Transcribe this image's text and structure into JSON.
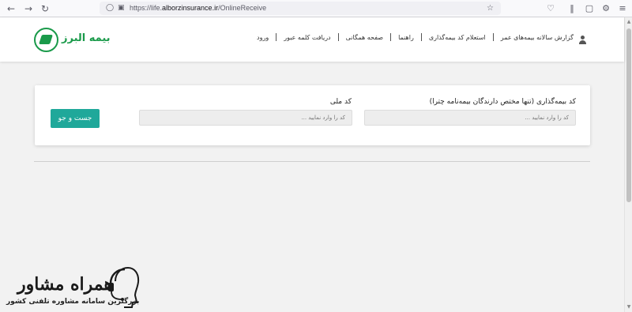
{
  "browser": {
    "url_prefix": "https://life.",
    "url_domain": "alborzinsurance.ir",
    "url_path": "/OnlineReceive"
  },
  "site": {
    "logo_text": "بیمه البرز",
    "nav": {
      "login": "ورود",
      "recover_password": "دریافت کلمه عبور",
      "public_page": "صفحه همگانی",
      "guide": "راهنما",
      "code_inquiry": "استعلام کد بیمه‌گذاری",
      "annual_report": "گزارش سالانه بیمه‌های عمر"
    }
  },
  "search": {
    "insurer_code_label": "کد بیمه‌گذاری (تنها مختص دارندگان بیمه‌نامه چترا)",
    "insurer_code_placeholder": "کد را وارد نمایید ...",
    "national_code_label": "کد ملی",
    "national_code_placeholder": "کد را وارد نمایید ...",
    "submit_label": "جست و جو"
  },
  "watermark": {
    "brand": "همراه مشاور",
    "tagline": "بزرگترین سامانه مشاوره تلفنی کشور"
  },
  "colors": {
    "brand_green": "#1a9a4a",
    "button_teal": "#1fa89a"
  }
}
